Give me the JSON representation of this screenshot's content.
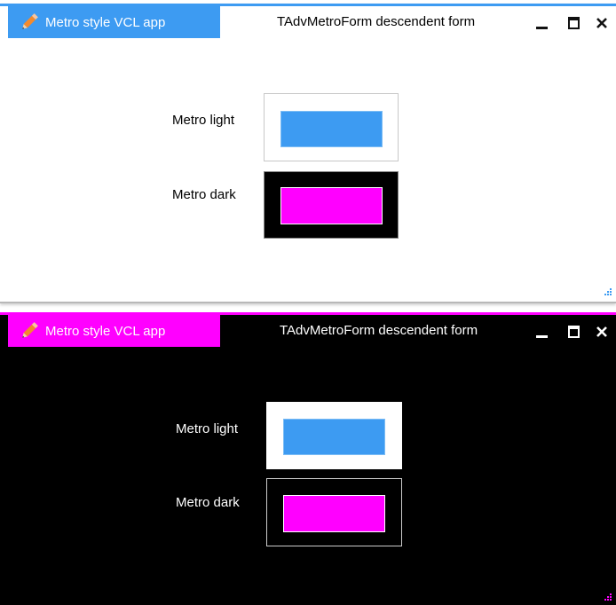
{
  "windows": {
    "light": {
      "app_tab_label": "Metro style VCL app",
      "form_title": "TAdvMetroForm descendent form",
      "rows": [
        {
          "label": "Metro light",
          "panel": "#ffffff",
          "panel_border": "#c8c8c8",
          "swatch": "#3d9bf2"
        },
        {
          "label": "Metro dark",
          "panel": "#000000",
          "panel_border": "#888888",
          "swatch": "#ff00ff"
        }
      ],
      "accent": "#3d9bf2"
    },
    "dark": {
      "app_tab_label": "Metro style VCL app",
      "form_title": "TAdvMetroForm descendent form",
      "rows": [
        {
          "label": "Metro light",
          "panel": "#ffffff",
          "panel_border": "#ffffff",
          "swatch": "#3d9bf2"
        },
        {
          "label": "Metro dark",
          "panel": "#000000",
          "panel_border": "#cccccc",
          "swatch": "#ff00ff"
        }
      ],
      "accent": "#ff00ff"
    }
  },
  "icons": {
    "app_icon": "pencil-icon",
    "minimize": "minimize-icon",
    "maximize": "maximize-icon",
    "close": "close-icon",
    "grip": "resize-grip-icon"
  }
}
